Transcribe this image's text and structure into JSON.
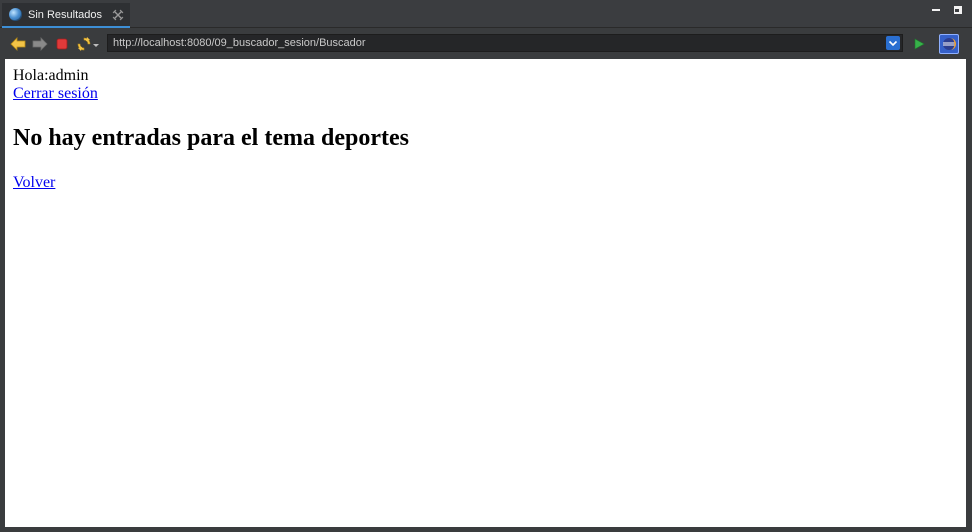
{
  "tab": {
    "title": "Sin Resultados"
  },
  "toolbar": {
    "url": "http://localhost:8080/09_buscador_sesion/Buscador"
  },
  "page": {
    "greeting": "Hola:admin",
    "logout_link": "Cerrar sesión",
    "heading": "No hay entradas para el tema deportes",
    "back_link": "Volver"
  },
  "colors": {
    "link": "#0000ee",
    "tab_accent": "#3d8fd6",
    "chrome_bg": "#3a3c3e"
  }
}
